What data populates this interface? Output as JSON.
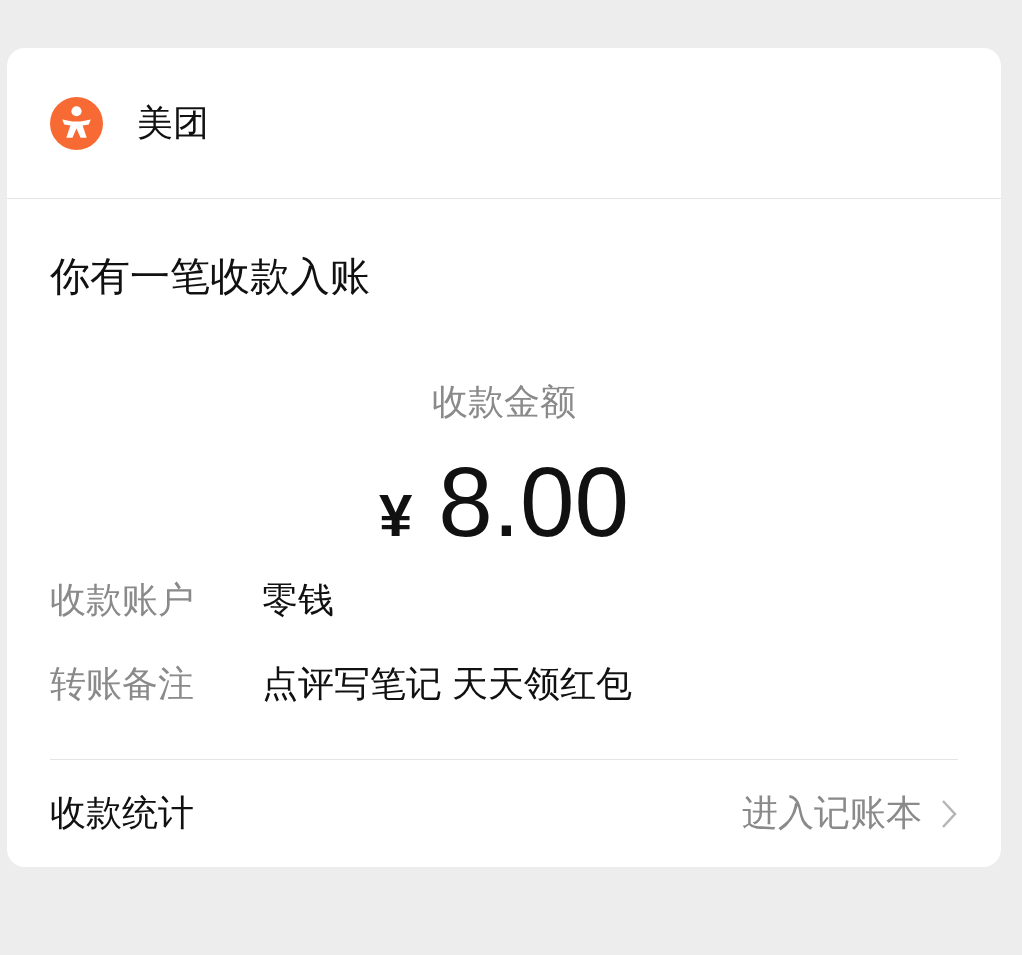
{
  "header": {
    "app_name": "美团"
  },
  "title": "你有一笔收款入账",
  "amount": {
    "label": "收款金额",
    "currency": "¥",
    "value": "8.00"
  },
  "details": [
    {
      "label": "收款账户",
      "value": "零钱"
    },
    {
      "label": "转账备注",
      "value": "点评写笔记 天天领红包"
    }
  ],
  "footer": {
    "label": "收款统计",
    "link": "进入记账本"
  }
}
